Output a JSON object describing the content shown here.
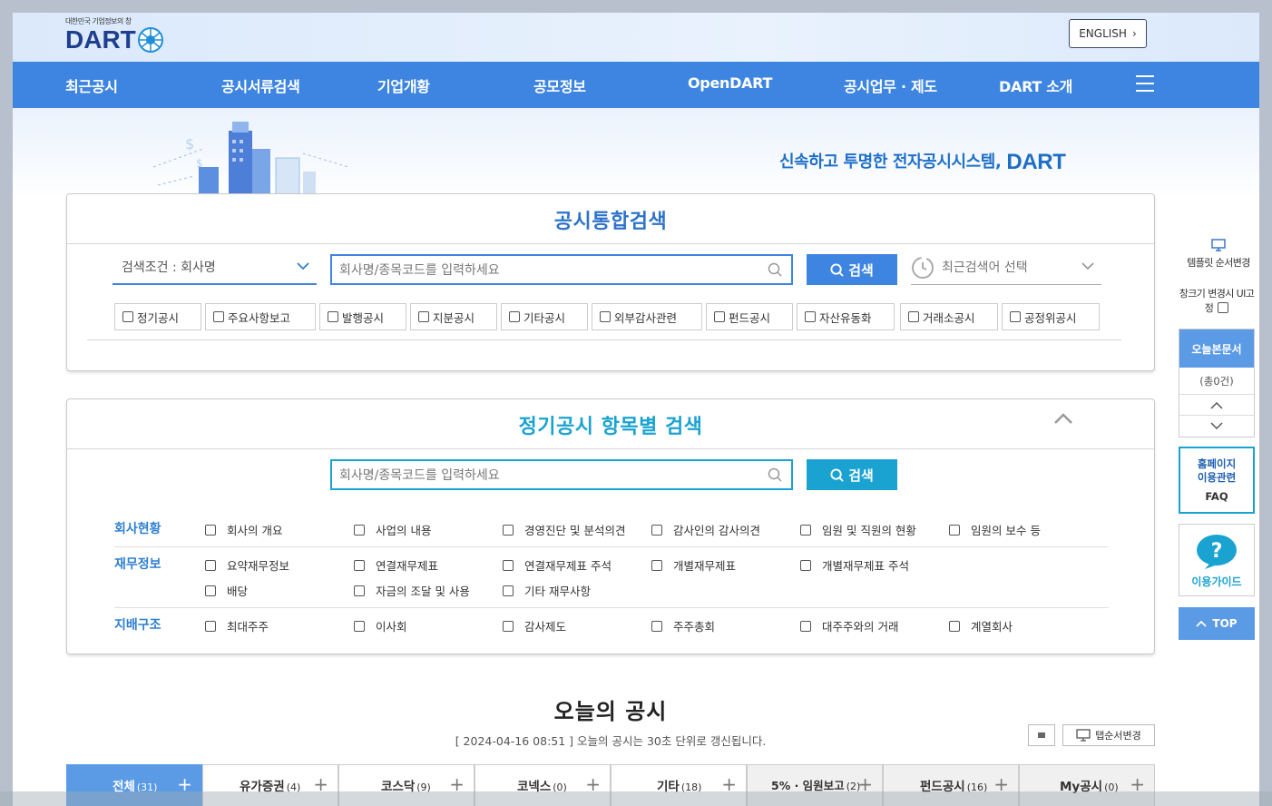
{
  "header": {
    "logo_sub": "대한민국 기업정보의 창",
    "logo_text": "DART",
    "english_btn": "ENGLISH",
    "nav": [
      "최근공시",
      "공시서류검색",
      "기업개황",
      "공모정보",
      "OpenDART",
      "공시업무 · 제도",
      "DART 소개"
    ]
  },
  "hero": {
    "slogan": "신속하고 투명한 전자공시시스템,",
    "slogan_brand": "DART"
  },
  "integrated_search": {
    "title": "공시통합검색",
    "condition": "검색조건 : 회사명",
    "placeholder": "회사명/종목코드를 입력하세요",
    "search_btn": "검색",
    "recent": "최근검색어 선택",
    "checkboxes": [
      "정기공시",
      "주요사항보고",
      "발행공시",
      "지분공시",
      "기타공시",
      "외부감사관련",
      "펀드공시",
      "자산유동화",
      "거래소공시",
      "공정위공시"
    ]
  },
  "periodic_search": {
    "title": "정기공시 항목별 검색",
    "placeholder": "회사명/종목코드를 입력하세요",
    "search_btn": "검색",
    "categories": [
      {
        "label": "회사현황",
        "items": [
          "회사의 개요",
          "사업의 내용",
          "경영진단 및 분석의견",
          "감사인의 감사의견",
          "임원 및 직원의 현황",
          "임원의 보수 등"
        ]
      },
      {
        "label": "재무정보",
        "items": [
          "요약재무정보",
          "연결재무제표",
          "연결재무제표 주석",
          "개별재무제표",
          "개별재무제표 주석",
          "배당",
          "자금의 조달 및 사용",
          "기타 재무사항"
        ]
      },
      {
        "label": "지배구조",
        "items": [
          "최대주주",
          "이사회",
          "감사제도",
          "주주총회",
          "대주주와의 거래",
          "계열회사"
        ]
      }
    ]
  },
  "today": {
    "title": "오늘의 공시",
    "subtitle": "[ 2024-04-16 08:51 ] 오늘의 공시는 30초 단위로 갱신됩니다.",
    "tab_order_btn": "탭순서변경",
    "tabs": [
      {
        "label": "전체",
        "count": "(31)"
      },
      {
        "label": "유가증권",
        "count": "(4)"
      },
      {
        "label": "코스닥",
        "count": "(9)"
      },
      {
        "label": "코넥스",
        "count": "(0)"
      },
      {
        "label": "기타",
        "count": "(18)"
      },
      {
        "label": "5% · 임원보고",
        "count": "(2)"
      },
      {
        "label": "펀드공시",
        "count": "(16)"
      },
      {
        "label": "My공시",
        "count": "(0)"
      }
    ]
  },
  "side": {
    "template_order": "템플릿 순서변경",
    "fix_ui": "창크기 변경시 UI고정",
    "today_docs": "오늘본문서",
    "today_count": "(총0건)",
    "faq_line1": "홈페이지",
    "faq_line2": "이용관련",
    "faq_line3": "FAQ",
    "guide": "이용가이드",
    "top": "TOP"
  },
  "colors": {
    "nav_bg": "#3d85e0",
    "brand": "#1e3f8f",
    "teal": "#1aa3d0"
  }
}
